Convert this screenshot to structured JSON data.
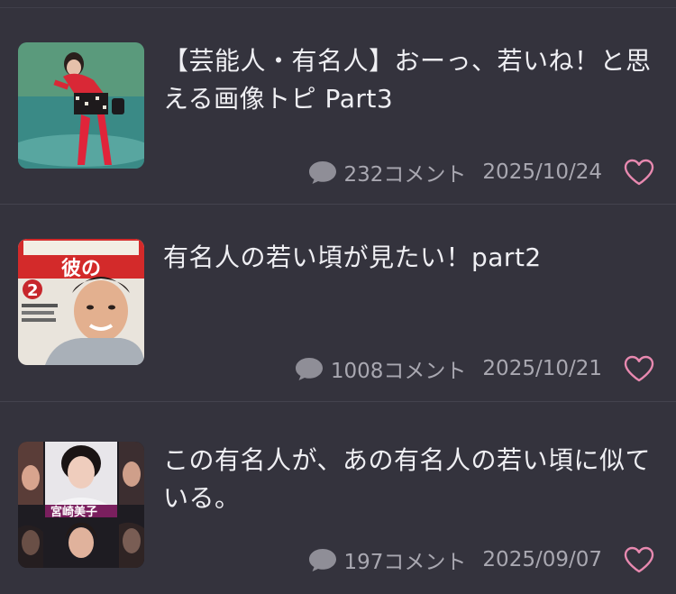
{
  "topics": [
    {
      "title": "【芸能人・有名人】おーっ、若いね！と思える画像トピ Part3",
      "comment_count": "232コメント",
      "date": "2025/10/24",
      "thumbnail": "woman-red-outfit-photo"
    },
    {
      "title": "有名人の若い頃が見たい！part2",
      "comment_count": "1008コメント",
      "date": "2025/10/21",
      "thumbnail": "magazine-cover-young-man",
      "thumbnail_text": {
        "headline": "彼の",
        "badge": "2"
      }
    },
    {
      "title": "この有名人が、あの有名人の若い頃に似ている。",
      "comment_count": "197コメント",
      "date": "2025/09/07",
      "thumbnail": "collage-portraits",
      "thumbnail_text": {
        "name": "宮崎美子"
      }
    }
  ],
  "icons": {
    "comment": "speech-bubble-icon",
    "like": "heart-outline-icon"
  },
  "colors": {
    "background": "#34333d",
    "title_text": "#efeff3",
    "meta_text": "#a9a8b1",
    "heart": "#e889b0"
  }
}
